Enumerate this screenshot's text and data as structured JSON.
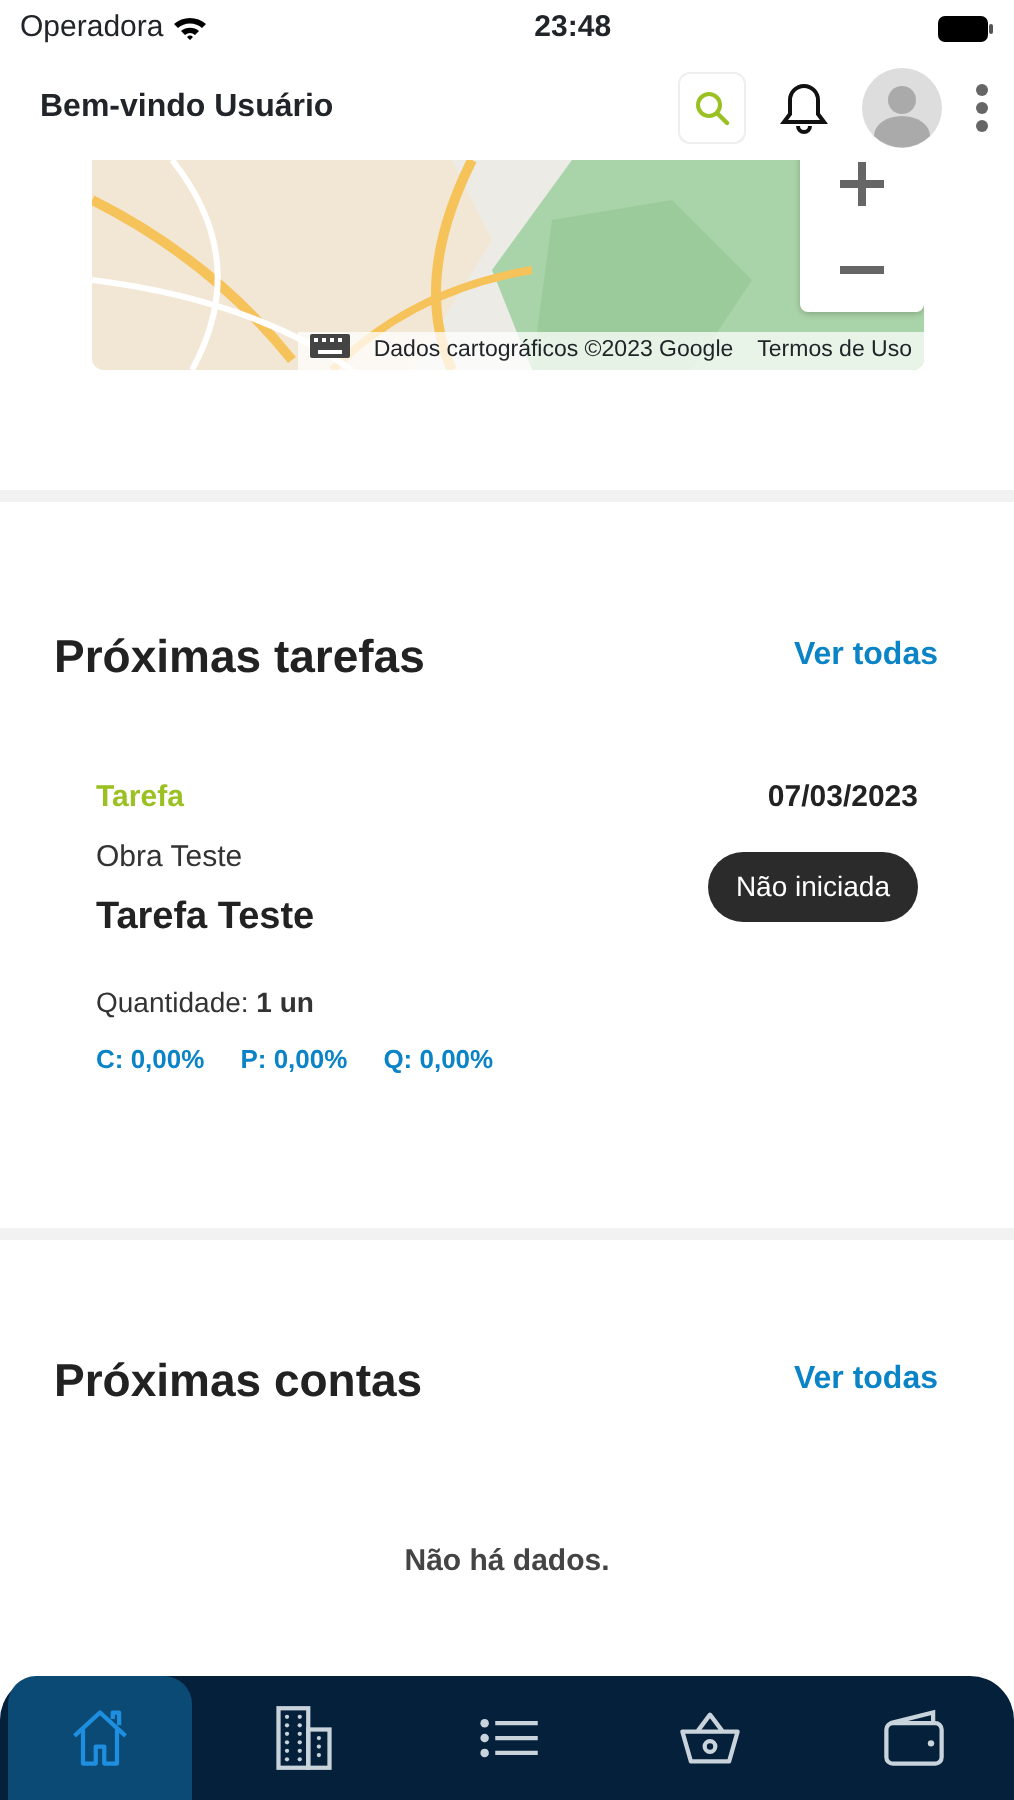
{
  "status_bar": {
    "carrier": "Operadora",
    "time": "23:48"
  },
  "header": {
    "title": "Bem-vindo Usuário"
  },
  "map": {
    "kind": "picture",
    "attribution": "Dados cartográficos ©2023 Google",
    "terms": "Termos de Uso"
  },
  "sections": [
    {
      "title": "Próximas tarefas",
      "link": "Ver todas",
      "tasks": [
        {
          "type": "Tarefa",
          "date": "07/03/2023",
          "project": "Obra Teste",
          "name": "Tarefa Teste",
          "status": "Não iniciada",
          "quantity_label": "Quantidade:",
          "quantity": "1 un",
          "metrics": [
            "C: 0,00%",
            "P: 0,00%",
            "Q: 0,00%"
          ]
        }
      ]
    },
    {
      "title": "Próximas contas",
      "link": "Ver todas",
      "empty_text": "Não há dados."
    }
  ],
  "bottom_nav": [
    {
      "kind": "home",
      "selected": true
    },
    {
      "kind": "buildings",
      "selected": false
    },
    {
      "kind": "list",
      "selected": false
    },
    {
      "kind": "basket",
      "selected": false
    },
    {
      "kind": "wallet",
      "selected": false
    }
  ]
}
